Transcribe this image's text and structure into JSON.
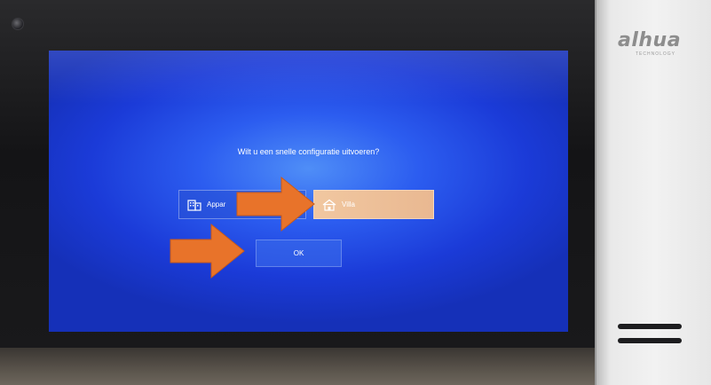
{
  "device": {
    "brand": "alhua",
    "brand_sub": "TECHNOLOGY"
  },
  "dialog": {
    "question": "Wilt u een snelle configuratie uitvoeren?",
    "options": [
      {
        "label": "Appar",
        "icon": "building-icon",
        "selected": false
      },
      {
        "label": "Villa",
        "icon": "house-icon",
        "selected": true
      }
    ],
    "ok_label": "OK"
  },
  "colors": {
    "screen_blue": "#2c5df0",
    "selected_option": "#ecbf98",
    "arrow_orange": "#e8732a"
  }
}
